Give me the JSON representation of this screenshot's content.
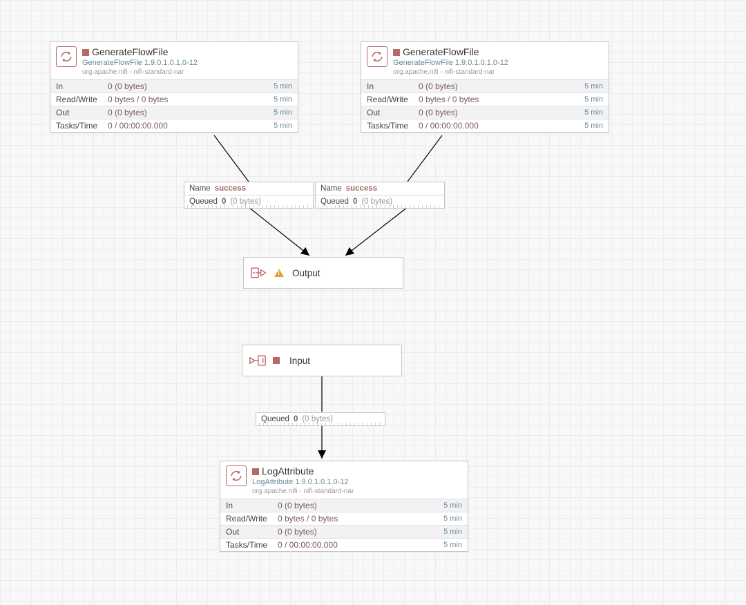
{
  "processors": {
    "p1": {
      "name": "GenerateFlowFile",
      "type": "GenerateFlowFile 1.9.0.1.0.1.0-12",
      "bundle": "org.apache.nifi - nifi-standard-nar",
      "stats": {
        "in": {
          "label": "In",
          "value": "0 (0 bytes)",
          "time": "5 min"
        },
        "rw": {
          "label": "Read/Write",
          "value": "0 bytes / 0 bytes",
          "time": "5 min"
        },
        "out": {
          "label": "Out",
          "value": "0 (0 bytes)",
          "time": "5 min"
        },
        "task": {
          "label": "Tasks/Time",
          "value": "0 / 00:00:00.000",
          "time": "5 min"
        }
      }
    },
    "p2": {
      "name": "GenerateFlowFile",
      "type": "GenerateFlowFile 1.9.0.1.0.1.0-12",
      "bundle": "org.apache.nifi - nifi-standard-nar",
      "stats": {
        "in": {
          "label": "In",
          "value": "0 (0 bytes)",
          "time": "5 min"
        },
        "rw": {
          "label": "Read/Write",
          "value": "0 bytes / 0 bytes",
          "time": "5 min"
        },
        "out": {
          "label": "Out",
          "value": "0 (0 bytes)",
          "time": "5 min"
        },
        "task": {
          "label": "Tasks/Time",
          "value": "0 / 00:00:00.000",
          "time": "5 min"
        }
      }
    },
    "p3": {
      "name": "LogAttribute",
      "type": "LogAttribute 1.9.0.1.0.1.0-12",
      "bundle": "org.apache.nifi - nifi-standard-nar",
      "stats": {
        "in": {
          "label": "In",
          "value": "0 (0 bytes)",
          "time": "5 min"
        },
        "rw": {
          "label": "Read/Write",
          "value": "0 bytes / 0 bytes",
          "time": "5 min"
        },
        "out": {
          "label": "Out",
          "value": "0 (0 bytes)",
          "time": "5 min"
        },
        "task": {
          "label": "Tasks/Time",
          "value": "0 / 00:00:00.000",
          "time": "5 min"
        }
      }
    }
  },
  "connections": {
    "c1": {
      "nameLabel": "Name",
      "name": "success",
      "queuedLabel": "Queued",
      "queuedCount": "0",
      "queuedSize": "(0 bytes)"
    },
    "c2": {
      "nameLabel": "Name",
      "name": "success",
      "queuedLabel": "Queued",
      "queuedCount": "0",
      "queuedSize": "(0 bytes)"
    },
    "c3": {
      "queuedLabel": "Queued",
      "queuedCount": "0",
      "queuedSize": "(0 bytes)"
    }
  },
  "ports": {
    "output": {
      "label": "Output"
    },
    "input": {
      "label": "Input"
    }
  }
}
